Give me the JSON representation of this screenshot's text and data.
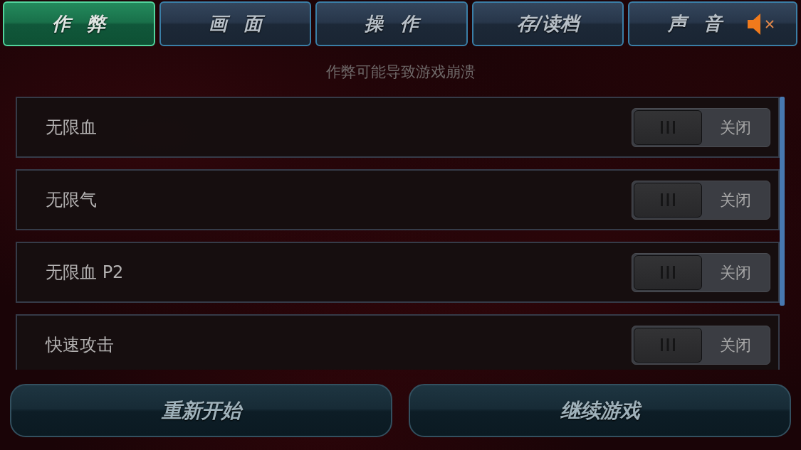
{
  "tabs": [
    {
      "label": "作 弊",
      "selected": true
    },
    {
      "label": "画 面",
      "selected": false
    },
    {
      "label": "操 作",
      "selected": false
    },
    {
      "label": "存/读档",
      "selected": false
    },
    {
      "label": "声 音",
      "selected": false,
      "muted": true
    }
  ],
  "notice": "作弊可能导致游戏崩溃",
  "cheats": [
    {
      "label": "无限血",
      "on": false,
      "state_text": "关闭"
    },
    {
      "label": "无限气",
      "on": false,
      "state_text": "关闭"
    },
    {
      "label": "无限血 P2",
      "on": false,
      "state_text": "关闭"
    },
    {
      "label": "快速攻击",
      "on": false,
      "state_text": "关闭"
    }
  ],
  "buttons": [
    "重新开始",
    "继续游戏"
  ]
}
